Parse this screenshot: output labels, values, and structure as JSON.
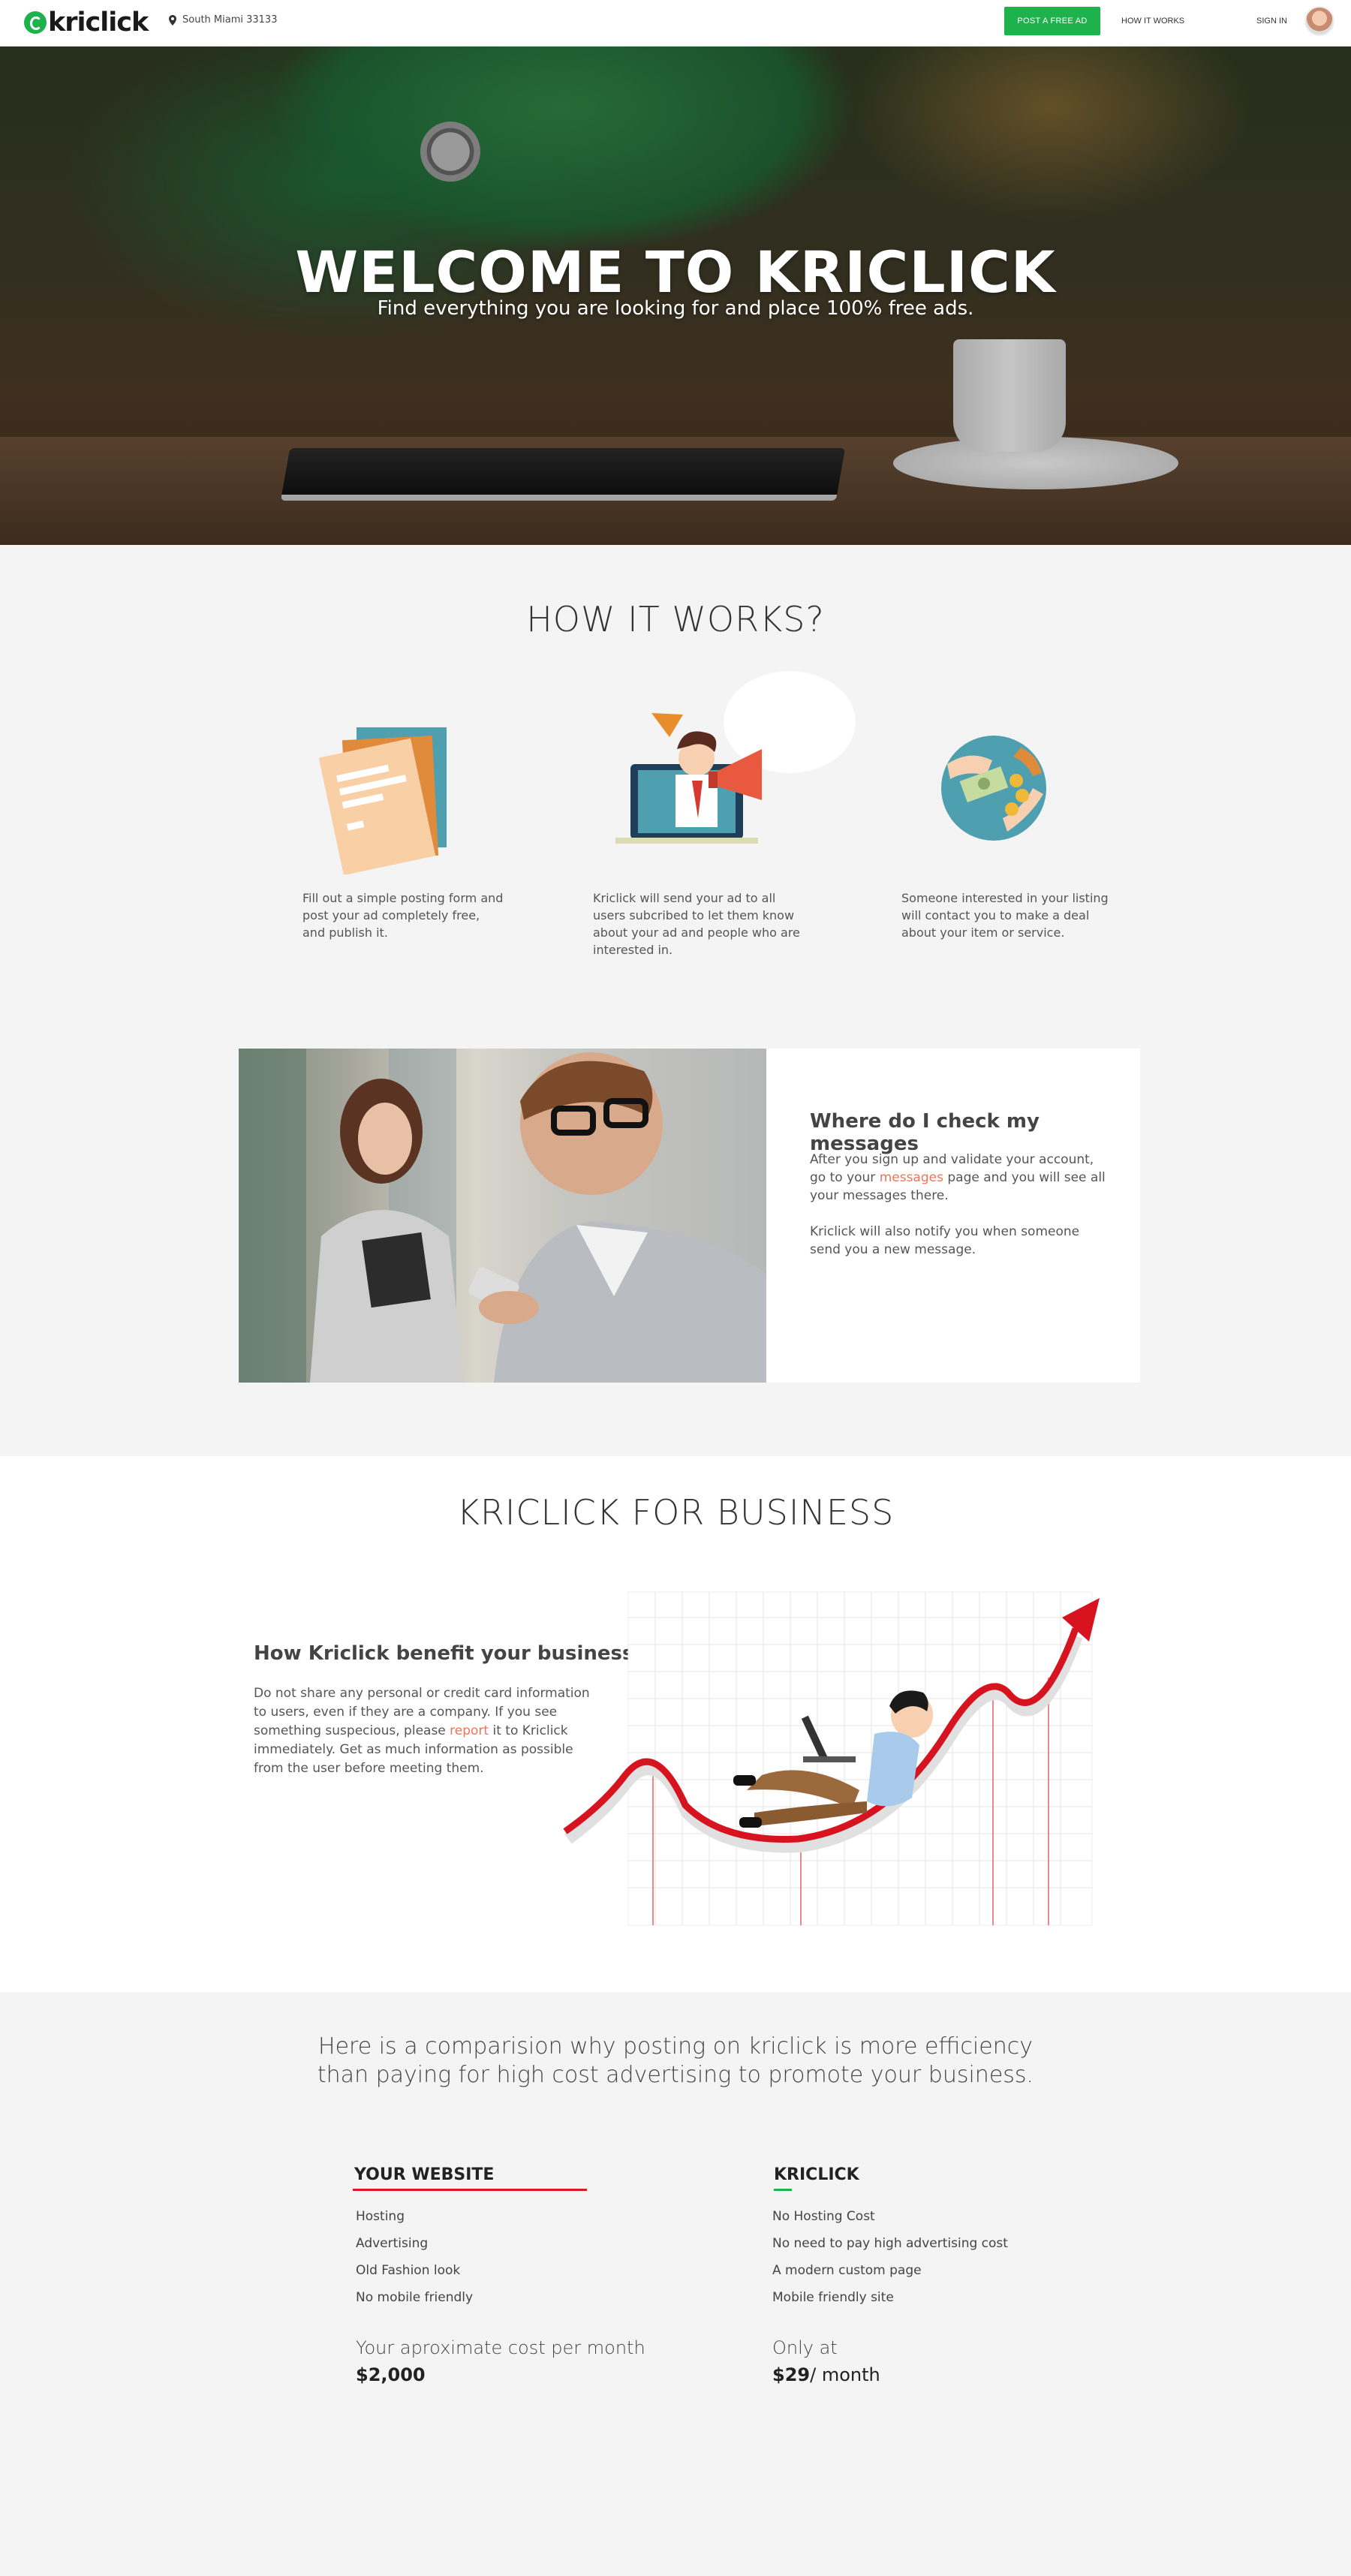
{
  "header": {
    "logo_text": "kriclick",
    "location": "South Miami 33133",
    "post_button": "POST A FREE AD",
    "how_it_works": "HOW IT WORKS",
    "sign_in": "SIGN IN"
  },
  "hero": {
    "title": "WELCOME TO KRICLICK",
    "subtitle": "Find everything you are looking for and place 100% free ads."
  },
  "how_it_works": {
    "title": "HOW IT WORKS?",
    "steps": [
      {
        "text": "Fill out a simple posting form and post your ad completely free, and publish it.",
        "icon": "documents-icon"
      },
      {
        "text": "Kriclick will send your ad to all users subcribed to let them know about your ad and people who are interested in.",
        "icon": "megaphone-man-icon"
      },
      {
        "text": "Someone interested in your listing will contact you to make a deal about your item or service.",
        "icon": "money-exchange-icon"
      }
    ]
  },
  "messages": {
    "title": "Where do I check my messages",
    "p1_before": "After you sign up and validate your account, go to your ",
    "p1_link": "messages",
    "p1_after": " page and you will see all your messages there.",
    "p2": "Kriclick will also notify you when someone send you a new message."
  },
  "business": {
    "title": "KRICLICK FOR BUSINESS",
    "subtitle": "How Kriclick benefit your business",
    "p_before": "Do not share any personal or credit card information to users, even if they are a company. If you see something suspecious, please ",
    "p_link": "report",
    "p_after": " it to Kriclick immediately. Get as much information as possible from the user before meeting them."
  },
  "comparison": {
    "heading": "Here is a comparision why posting on kriclick is more efficiency than paying for high cost advertising to promote your business.",
    "left": {
      "title": "YOUR WEBSITE",
      "items": [
        "Hosting",
        "Advertising",
        "Old Fashion look",
        "No mobile friendly"
      ],
      "cost_label": "Your aproximate cost per month",
      "cost_value": "$2,000",
      "accent": "#e0162b"
    },
    "right": {
      "title": "KRICLICK",
      "items": [
        "No Hosting Cost",
        "No need to pay high advertising cost",
        "A modern custom page",
        "Mobile friendly site"
      ],
      "cost_label": "Only at",
      "cost_value": "$29",
      "cost_suffix": "/ month",
      "accent": "#1db24b"
    }
  },
  "colors": {
    "brand_green": "#1db24b",
    "link_orange": "#f0735a",
    "accent_red": "#e0162b"
  }
}
